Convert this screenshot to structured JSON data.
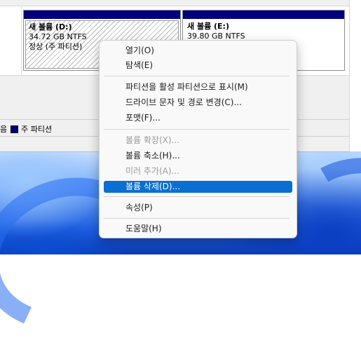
{
  "disk": {
    "partition_d": {
      "name": "새 볼륨  (D:)",
      "size": "34.72 GB NTFS",
      "status": "정상 (주 파티션)"
    },
    "partition_e": {
      "name": "새 볼륨  (E:)",
      "size": "39.80 GB NTFS"
    }
  },
  "legend": {
    "partial_label": "음",
    "primary_label": "주 파티션"
  },
  "colors": {
    "primary_partition": "#00007f",
    "menu_highlight": "#0a6fd0"
  },
  "menu": {
    "items": [
      {
        "label": "열기(O)",
        "enabled": true
      },
      {
        "label": "탐색(E)",
        "enabled": true
      },
      {
        "label": "파티션을 활성 파티션으로 표시(M)",
        "enabled": true
      },
      {
        "label": "드라이브 문자 및 경로 변경(C)...",
        "enabled": true
      },
      {
        "label": "포맷(F)...",
        "enabled": true
      },
      {
        "label": "볼륨 확장(X)...",
        "enabled": false
      },
      {
        "label": "볼륨 축소(H)...",
        "enabled": true
      },
      {
        "label": "미러 추가(A)...",
        "enabled": false
      },
      {
        "label": "볼륨 삭제(D)...",
        "enabled": true,
        "selected": true
      },
      {
        "label": "속성(P)",
        "enabled": true
      },
      {
        "label": "도움말(H)",
        "enabled": true
      }
    ]
  }
}
